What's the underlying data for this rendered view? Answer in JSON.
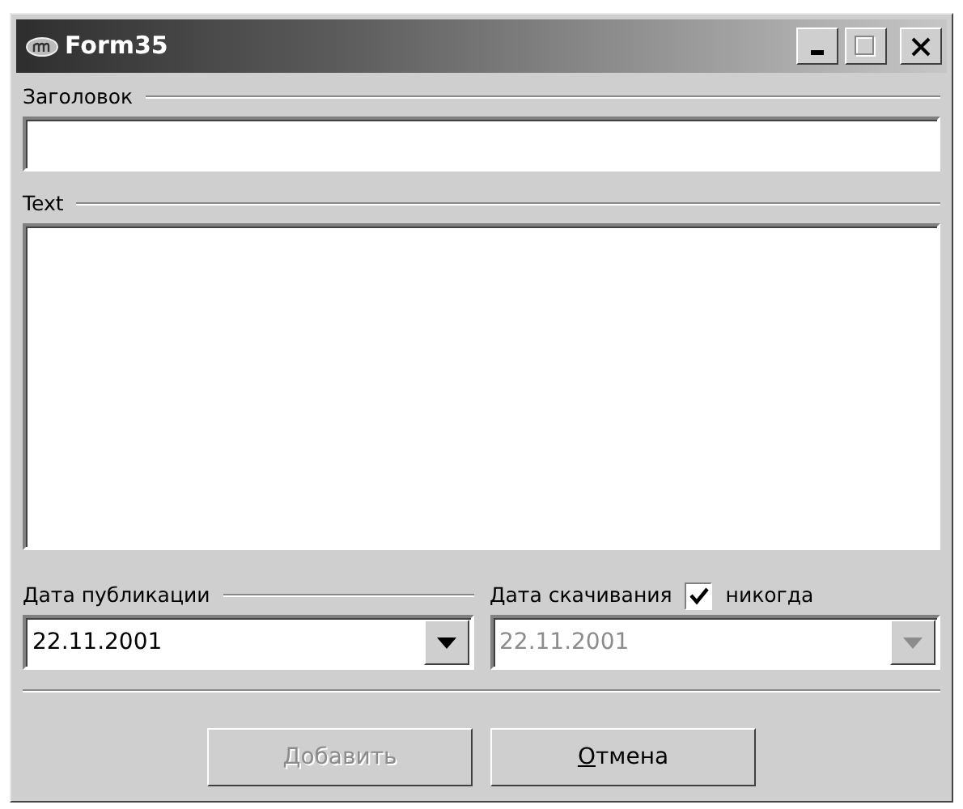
{
  "window": {
    "title": "Form35"
  },
  "title_field": {
    "label": "Заголовок"
  },
  "text_field": {
    "label": "Text"
  },
  "publication_date": {
    "label": "Дата публикации",
    "value": "22.11.2001",
    "disabled": false
  },
  "download_date": {
    "label": "Дата скачивания",
    "value": "22.11.2001",
    "disabled": true,
    "never": {
      "label": "никогда",
      "checked": true
    }
  },
  "buttons": [
    {
      "mnemonic": "Д",
      "label_rest": "обавить",
      "disabled": true
    },
    {
      "mnemonic": "О",
      "label_rest": "тмена",
      "disabled": false
    }
  ]
}
